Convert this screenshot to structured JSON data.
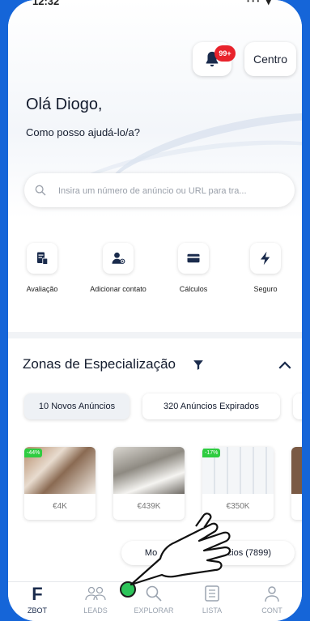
{
  "status": {
    "time": "12:32",
    "icons": "⋅⋅⋅ ▾"
  },
  "header": {
    "badge": "99+",
    "centro_label": "Centro"
  },
  "greeting": {
    "title": "Olá Diogo,",
    "subtitle": "Como posso ajudá-lo/a?"
  },
  "search": {
    "placeholder": "Insira um número de anúncio ou URL para tra..."
  },
  "actions": [
    {
      "label": "Avaliação",
      "icon": "document-icon"
    },
    {
      "label": "Adicionar contato",
      "icon": "add-contact-icon"
    },
    {
      "label": "Cálculos",
      "icon": "card-icon"
    },
    {
      "label": "Seguro",
      "icon": "lightning-icon"
    }
  ],
  "zones": {
    "title": "Zonas de Especialização"
  },
  "chips": [
    {
      "label": "10 Novos Anúncios"
    },
    {
      "label": "320 Anúncios Expirados"
    }
  ],
  "cards": [
    {
      "price": "€4K",
      "discount": "-44%"
    },
    {
      "price": "€439K",
      "discount": ""
    },
    {
      "price": "€350K",
      "discount": "-17%"
    }
  ],
  "more_button": {
    "left": "Mo",
    "right": "anúncios (7899)"
  },
  "tabs": [
    {
      "label": "ZBOT",
      "glyph": "F"
    },
    {
      "label": "LEADS"
    },
    {
      "label": "EXPLORAR"
    },
    {
      "label": "LISTA"
    },
    {
      "label": "CONT"
    }
  ],
  "colors": {
    "frame": "#1565d8",
    "accent": "#1a2b4c",
    "badge": "#e8232c",
    "discount": "#2ecc40"
  }
}
